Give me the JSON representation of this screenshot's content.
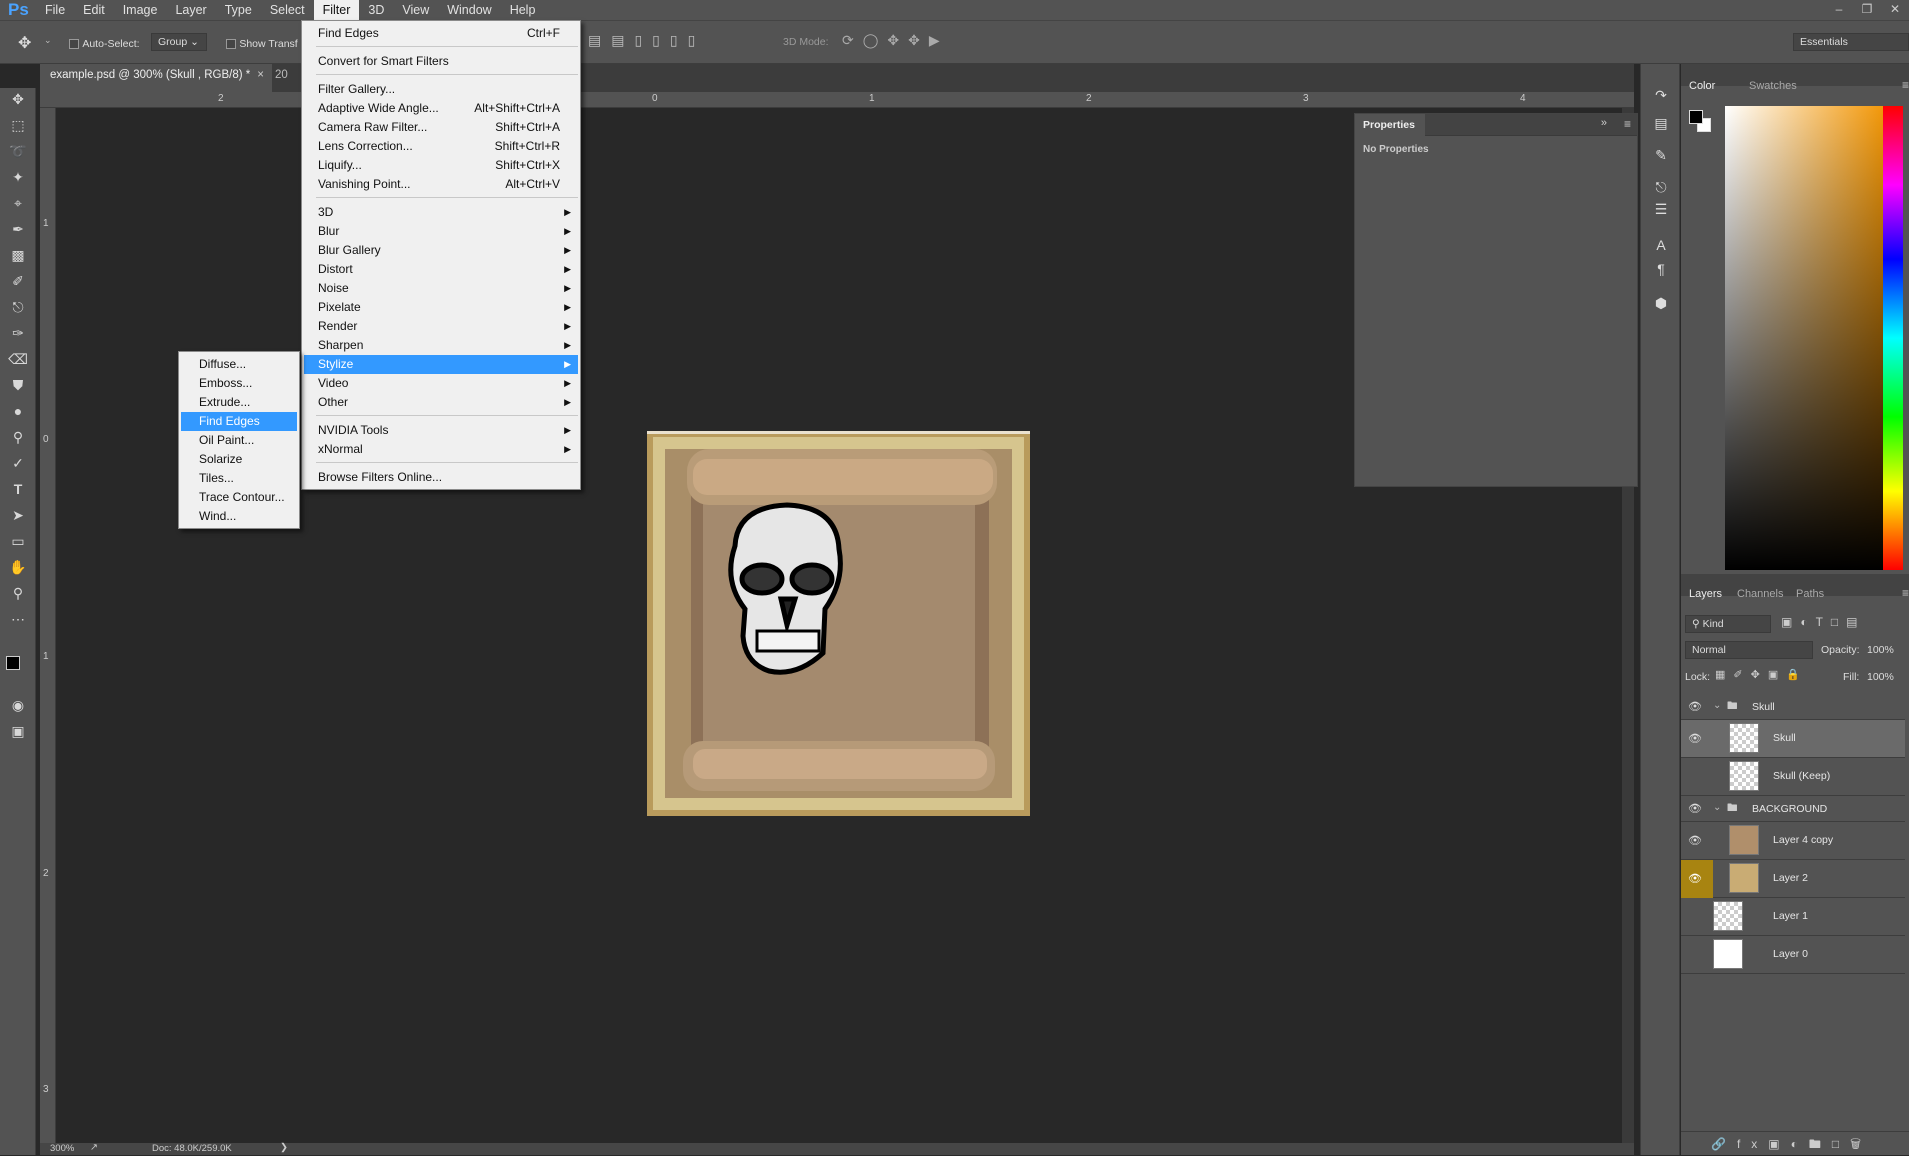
{
  "app": {
    "logo": "Ps"
  },
  "menubar": [
    "File",
    "Edit",
    "Image",
    "Layer",
    "Type",
    "Select",
    "Filter",
    "3D",
    "View",
    "Window",
    "Help"
  ],
  "options": {
    "auto_select": "Auto-Select:",
    "group": "Group",
    "show_transform": "Show Transf",
    "mode_3d": "3D Mode:",
    "workspace": "Essentials"
  },
  "document": {
    "tab_title": "example.psd @ 300% (Skull , RGB/8) *",
    "tab2": "20"
  },
  "rulers": {
    "h": [
      "2",
      "1",
      "0",
      "1",
      "2",
      "3",
      "4"
    ],
    "v": [
      "1",
      "0",
      "1",
      "2",
      "3"
    ]
  },
  "status": {
    "zoom": "300%",
    "doc": "Doc: 48.0K/259.0K"
  },
  "filter_menu": {
    "items": [
      {
        "label": "Find Edges",
        "shortcut": "Ctrl+F"
      },
      {
        "label": "Convert for Smart Filters",
        "shortcut": ""
      },
      {
        "label": "Filter Gallery...",
        "shortcut": ""
      },
      {
        "label": "Adaptive Wide Angle...",
        "shortcut": "Alt+Shift+Ctrl+A"
      },
      {
        "label": "Camera Raw Filter...",
        "shortcut": "Shift+Ctrl+A"
      },
      {
        "label": "Lens Correction...",
        "shortcut": "Shift+Ctrl+R"
      },
      {
        "label": "Liquify...",
        "shortcut": "Shift+Ctrl+X"
      },
      {
        "label": "Vanishing Point...",
        "shortcut": "Alt+Ctrl+V"
      },
      {
        "label": "3D"
      },
      {
        "label": "Blur"
      },
      {
        "label": "Blur Gallery"
      },
      {
        "label": "Distort"
      },
      {
        "label": "Noise"
      },
      {
        "label": "Pixelate"
      },
      {
        "label": "Render"
      },
      {
        "label": "Sharpen"
      },
      {
        "label": "Stylize"
      },
      {
        "label": "Video"
      },
      {
        "label": "Other"
      },
      {
        "label": "NVIDIA Tools"
      },
      {
        "label": "xNormal"
      },
      {
        "label": "Browse Filters Online..."
      }
    ]
  },
  "stylize_menu": [
    "Diffuse...",
    "Emboss...",
    "Extrude...",
    "Find Edges",
    "Oil Paint...",
    "Solarize",
    "Tiles...",
    "Trace Contour...",
    "Wind..."
  ],
  "properties": {
    "title": "Properties",
    "empty": "No Properties"
  },
  "color_panel": {
    "tabs": [
      "Color",
      "Swatches"
    ],
    "hue_color": "#f29400"
  },
  "layers_panel": {
    "tabs": [
      "Layers",
      "Channels",
      "Paths"
    ],
    "kind": "Kind",
    "blend": "Normal",
    "opacity_label": "Opacity:",
    "opacity": "100%",
    "lock_label": "Lock:",
    "fill_label": "Fill:",
    "fill": "100%",
    "layers": [
      "Skull",
      "Skull",
      "Skull (Keep)",
      "BACKGROUND",
      "Layer 4 copy",
      "Layer 2",
      "Layer 1",
      "Layer 0"
    ]
  }
}
